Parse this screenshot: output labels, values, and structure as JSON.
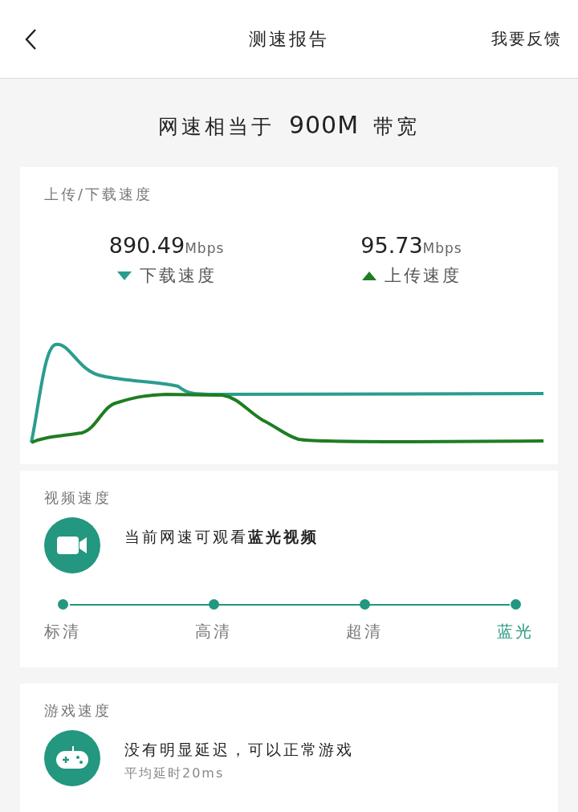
{
  "header": {
    "title": "测速报告",
    "action": "我要反馈"
  },
  "summary": {
    "prefix": "网速相当于",
    "value": "900M",
    "suffix": "带宽"
  },
  "speed_card": {
    "title": "上传/下载速度",
    "speeds": [
      {
        "value": "890.49",
        "unit": "Mbps",
        "label": "下载速度",
        "kind": "download",
        "color": "#2a9d8f"
      },
      {
        "value": "95.73",
        "unit": "Mbps",
        "label": "上传速度",
        "kind": "upload",
        "color": "#1e7d22"
      }
    ]
  },
  "video_card": {
    "title": "视频速度",
    "message": "当前网速可观看**蓝光视频**",
    "levels": [
      {
        "label": "标清",
        "selected": false
      },
      {
        "label": "高清",
        "selected": false
      },
      {
        "label": "超清",
        "selected": false
      },
      {
        "label": "蓝光",
        "selected": true
      }
    ]
  },
  "game_card": {
    "title": "游戏速度",
    "message": "没有明显延迟，可以正常游戏",
    "detail": "平均延时20ms"
  }
}
